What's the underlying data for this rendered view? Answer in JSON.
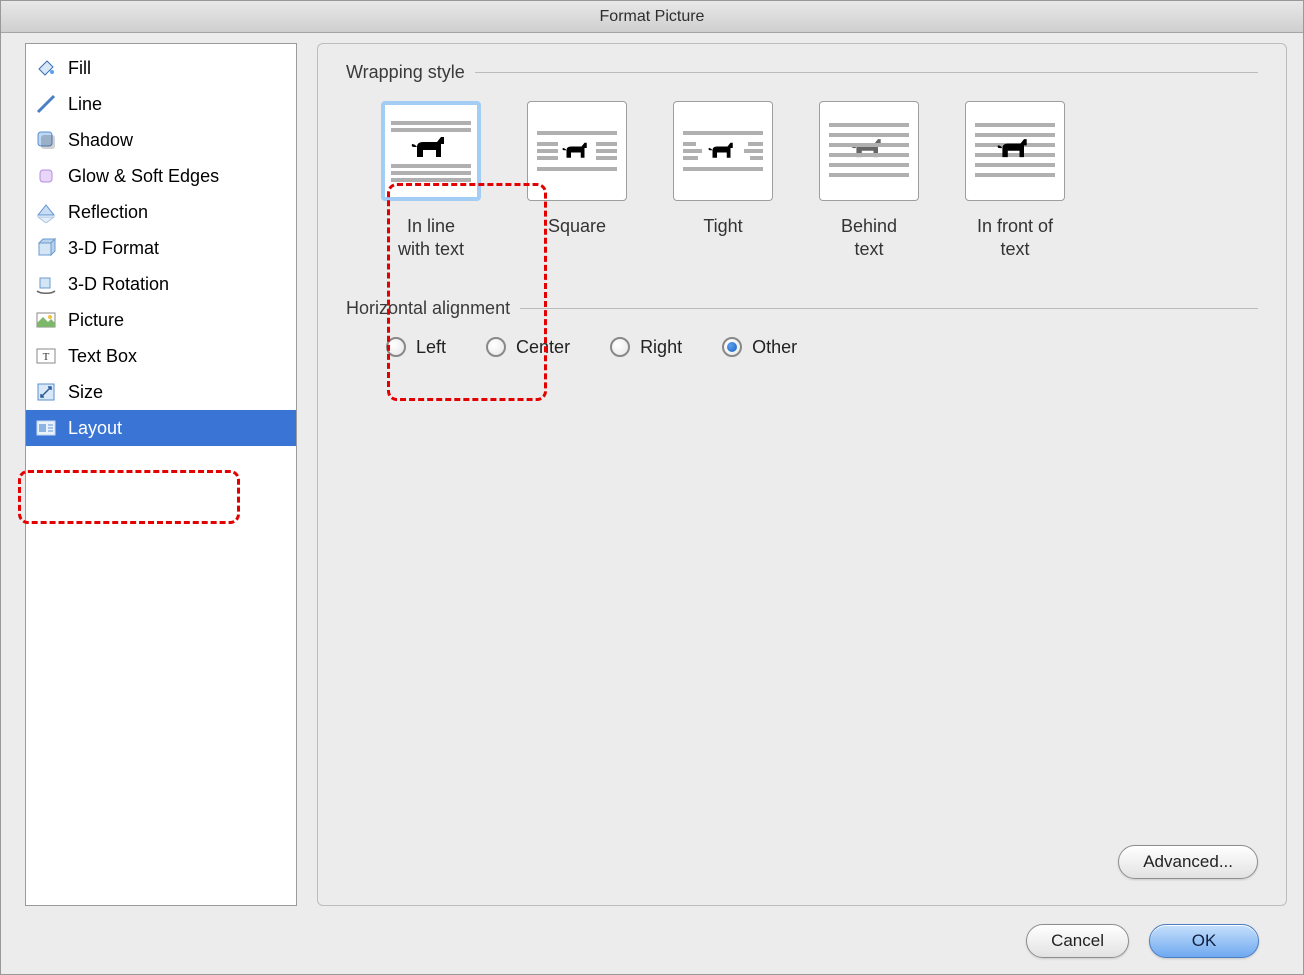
{
  "title": "Format Picture",
  "sidebar": {
    "items": [
      {
        "label": "Fill"
      },
      {
        "label": "Line"
      },
      {
        "label": "Shadow"
      },
      {
        "label": "Glow & Soft Edges"
      },
      {
        "label": "Reflection"
      },
      {
        "label": "3-D Format"
      },
      {
        "label": "3-D Rotation"
      },
      {
        "label": "Picture"
      },
      {
        "label": "Text Box"
      },
      {
        "label": "Size"
      },
      {
        "label": "Layout"
      }
    ],
    "selected": "Layout"
  },
  "sections": {
    "wrapping": "Wrapping style",
    "align": "Horizontal alignment"
  },
  "wrapping": {
    "options": [
      {
        "label": "In line\nwith text"
      },
      {
        "label": "Square"
      },
      {
        "label": "Tight"
      },
      {
        "label": "Behind\ntext"
      },
      {
        "label": "In front of\ntext"
      }
    ],
    "selected": "In line\nwith text"
  },
  "align": {
    "options": [
      {
        "label": "Left"
      },
      {
        "label": "Center"
      },
      {
        "label": "Right"
      },
      {
        "label": "Other"
      }
    ],
    "selected": "Other"
  },
  "buttons": {
    "advanced": "Advanced...",
    "cancel": "Cancel",
    "ok": "OK"
  }
}
